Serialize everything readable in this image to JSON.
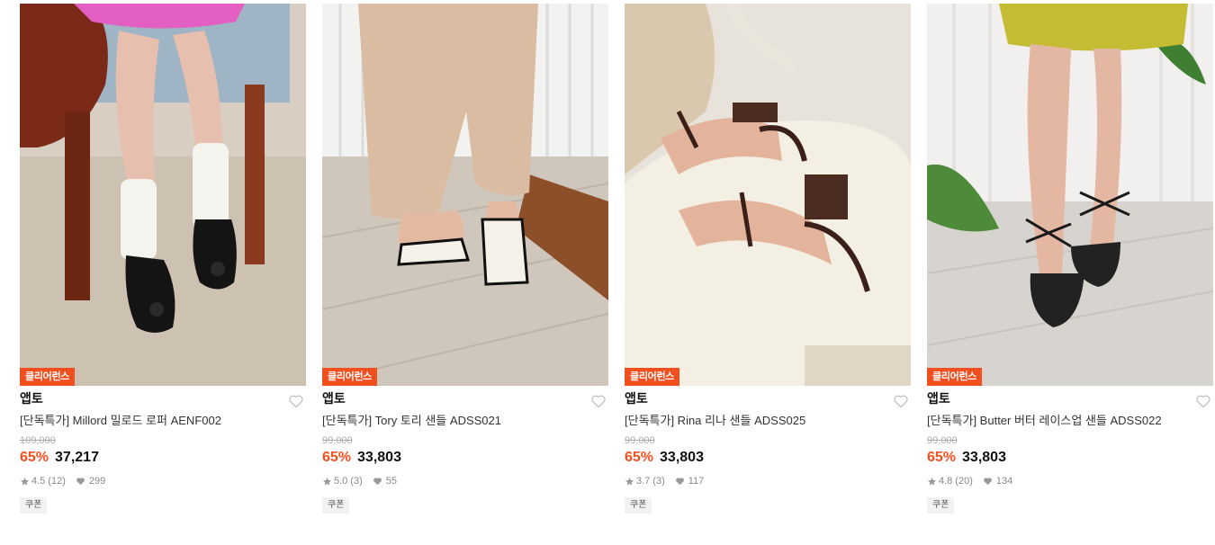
{
  "products": [
    {
      "badge": "클리어런스",
      "brand": "앱토",
      "name": "[단독특가] Millord 밀로드 로퍼 AENF002",
      "original_price": "109,000",
      "discount_rate": "65%",
      "sale_price": "37,217",
      "rating": "4.5",
      "review_count": "(12)",
      "likes": "299",
      "coupon": "쿠폰",
      "image": "black-loafers-white-socks"
    },
    {
      "badge": "클리어런스",
      "brand": "앱토",
      "name": "[단독특가] Tory 토리 샌들 ADSS021",
      "original_price": "99,000",
      "discount_rate": "65%",
      "sale_price": "33,803",
      "rating": "5.0",
      "review_count": "(3)",
      "likes": "55",
      "coupon": "쿠폰",
      "image": "white-toe-ring-sandals"
    },
    {
      "badge": "클리어런스",
      "brand": "앱토",
      "name": "[단독특가] Rina 리나 샌들 ADSS025",
      "original_price": "99,000",
      "discount_rate": "65%",
      "sale_price": "33,803",
      "rating": "3.7",
      "review_count": "(3)",
      "likes": "117",
      "coupon": "쿠폰",
      "image": "brown-strappy-heel-sandals"
    },
    {
      "badge": "클리어런스",
      "brand": "앱토",
      "name": "[단독특가] Butter 버터 레이스업 샌들 ADSS022",
      "original_price": "99,000",
      "discount_rate": "65%",
      "sale_price": "33,803",
      "rating": "4.8",
      "review_count": "(20)",
      "likes": "134",
      "coupon": "쿠폰",
      "image": "black-lace-up-sandals"
    }
  ],
  "colors": {
    "accent": "#f24f1f",
    "badge_text": "#ffffff",
    "strike": "#aaaaaa",
    "meta": "#888888"
  },
  "icons": {
    "wishlist": "heart-outline-icon",
    "rating": "star-icon",
    "likes": "heart-filled-icon"
  }
}
